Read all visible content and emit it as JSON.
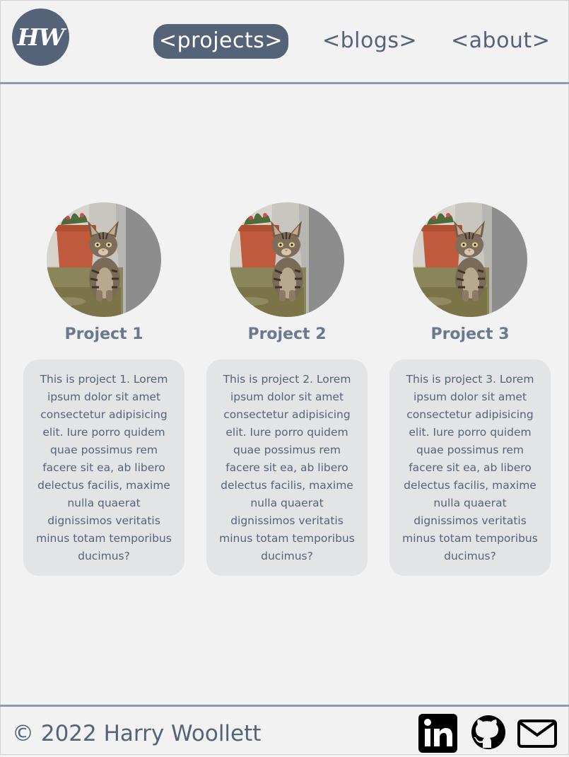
{
  "header": {
    "logo_text": "HW",
    "nav": [
      {
        "label": "<projects>",
        "active": true
      },
      {
        "label": "<blogs>",
        "active": false
      },
      {
        "label": "<about>",
        "active": false
      }
    ]
  },
  "projects": [
    {
      "title": "Project 1",
      "image": "kitten-photo",
      "description": "This is project 1. Lorem ipsum dolor sit amet consectetur adipisicing elit. Iure porro quidem quae possimus rem facere sit ea, ab libero delectus facilis, maxime nulla quaerat dignissimos veritatis minus totam temporibus ducimus?"
    },
    {
      "title": "Project 2",
      "image": "kitten-photo",
      "description": "This is project 2. Lorem ipsum dolor sit amet consectetur adipisicing elit. Iure porro quidem quae possimus rem facere sit ea, ab libero delectus facilis, maxime nulla quaerat dignissimos veritatis minus totam temporibus ducimus?"
    },
    {
      "title": "Project 3",
      "image": "kitten-photo",
      "description": "This is project 3. Lorem ipsum dolor sit amet consectetur adipisicing elit. Iure porro quidem quae possimus rem facere sit ea, ab libero delectus facilis, maxime nulla quaerat dignissimos veritatis minus totam temporibus ducimus?"
    }
  ],
  "footer": {
    "copyright": "© 2022 Harry Woollett",
    "social": [
      {
        "icon": "linkedin-icon"
      },
      {
        "icon": "github-icon"
      },
      {
        "icon": "email-icon"
      }
    ]
  },
  "colors": {
    "accent": "#556379",
    "background": "#f2f2f2",
    "card": "#e3e4e6",
    "divider": "#8c9aab"
  }
}
